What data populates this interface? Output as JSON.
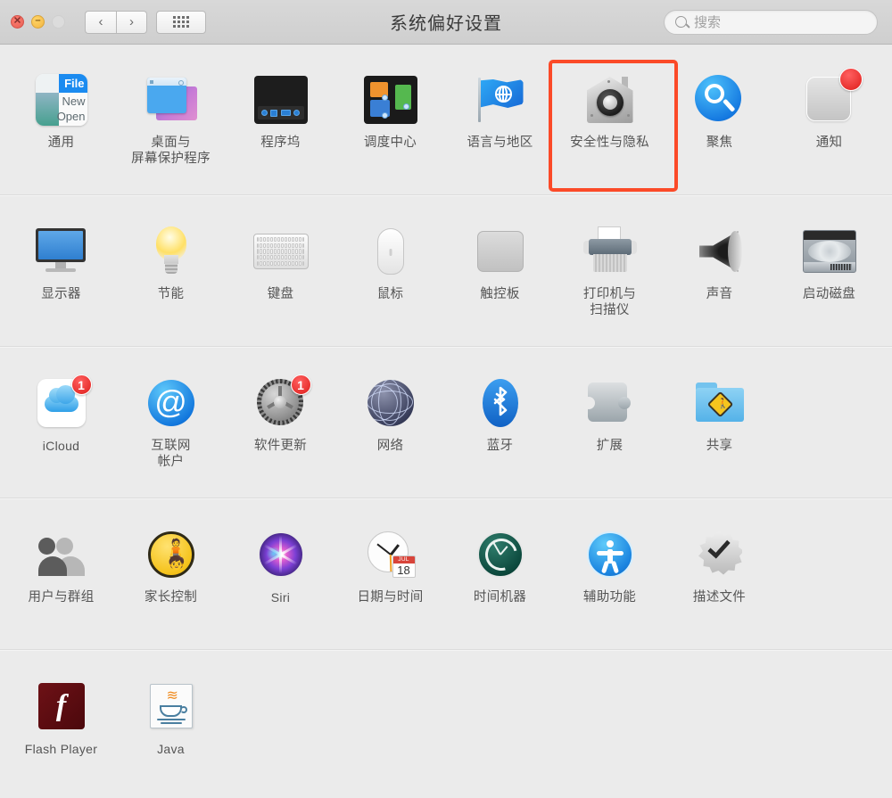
{
  "window": {
    "title": "系统偏好设置",
    "traffic_lights": [
      {
        "name": "close",
        "glyph": "✕"
      },
      {
        "name": "minimize",
        "glyph": "−"
      },
      {
        "name": "zoom",
        "glyph": ""
      }
    ],
    "nav": {
      "back": "‹",
      "forward": "›",
      "grid": "grid-icon"
    },
    "search": {
      "placeholder": "搜索",
      "value": "",
      "icon": "search-icon"
    }
  },
  "highlight": {
    "target": "安全性与隐私",
    "color": "#fb4a28"
  },
  "rows": [
    {
      "panes": [
        {
          "label": "通用",
          "icon": "general-icon",
          "art": {
            "t1": "File",
            "t2": "New",
            "t3": "Open"
          }
        },
        {
          "label": "桌面与\n屏幕保护程序",
          "icon": "desktop-screensaver-icon"
        },
        {
          "label": "程序坞",
          "icon": "dock-icon"
        },
        {
          "label": "调度中心",
          "icon": "mission-control-icon"
        },
        {
          "label": "语言与地区",
          "icon": "language-region-icon"
        },
        {
          "label": "安全性与隐私",
          "icon": "security-privacy-icon",
          "highlighted": true
        },
        {
          "label": "聚焦",
          "icon": "spotlight-icon"
        },
        {
          "label": "通知",
          "icon": "notifications-icon",
          "badge": "",
          "badge_dot": true
        }
      ]
    },
    {
      "panes": [
        {
          "label": "显示器",
          "icon": "displays-icon"
        },
        {
          "label": "节能",
          "icon": "energy-saver-icon"
        },
        {
          "label": "键盘",
          "icon": "keyboard-icon"
        },
        {
          "label": "鼠标",
          "icon": "mouse-icon"
        },
        {
          "label": "触控板",
          "icon": "trackpad-icon"
        },
        {
          "label": "打印机与\n扫描仪",
          "icon": "printers-scanners-icon"
        },
        {
          "label": "声音",
          "icon": "sound-icon"
        },
        {
          "label": "启动磁盘",
          "icon": "startup-disk-icon"
        }
      ]
    },
    {
      "panes": [
        {
          "label": "iCloud",
          "icon": "icloud-icon",
          "badge": "1",
          "latin": true
        },
        {
          "label": "互联网\n帐户",
          "icon": "internet-accounts-icon"
        },
        {
          "label": "软件更新",
          "icon": "software-update-icon",
          "badge": "1"
        },
        {
          "label": "网络",
          "icon": "network-icon"
        },
        {
          "label": "蓝牙",
          "icon": "bluetooth-icon"
        },
        {
          "label": "扩展",
          "icon": "extensions-icon"
        },
        {
          "label": "共享",
          "icon": "sharing-icon"
        }
      ]
    },
    {
      "panes": [
        {
          "label": "用户与群组",
          "icon": "users-groups-icon"
        },
        {
          "label": "家长控制",
          "icon": "parental-controls-icon"
        },
        {
          "label": "Siri",
          "icon": "siri-icon",
          "latin": true
        },
        {
          "label": "日期与时间",
          "icon": "date-time-icon",
          "art": {
            "month": "JUL",
            "day": "18"
          }
        },
        {
          "label": "时间机器",
          "icon": "time-machine-icon"
        },
        {
          "label": "辅助功能",
          "icon": "accessibility-icon"
        },
        {
          "label": "描述文件",
          "icon": "profiles-icon"
        }
      ]
    },
    {
      "panes": [
        {
          "label": "Flash Player",
          "icon": "flash-player-icon",
          "latin": true
        },
        {
          "label": "Java",
          "icon": "java-icon",
          "latin": true
        }
      ]
    }
  ]
}
